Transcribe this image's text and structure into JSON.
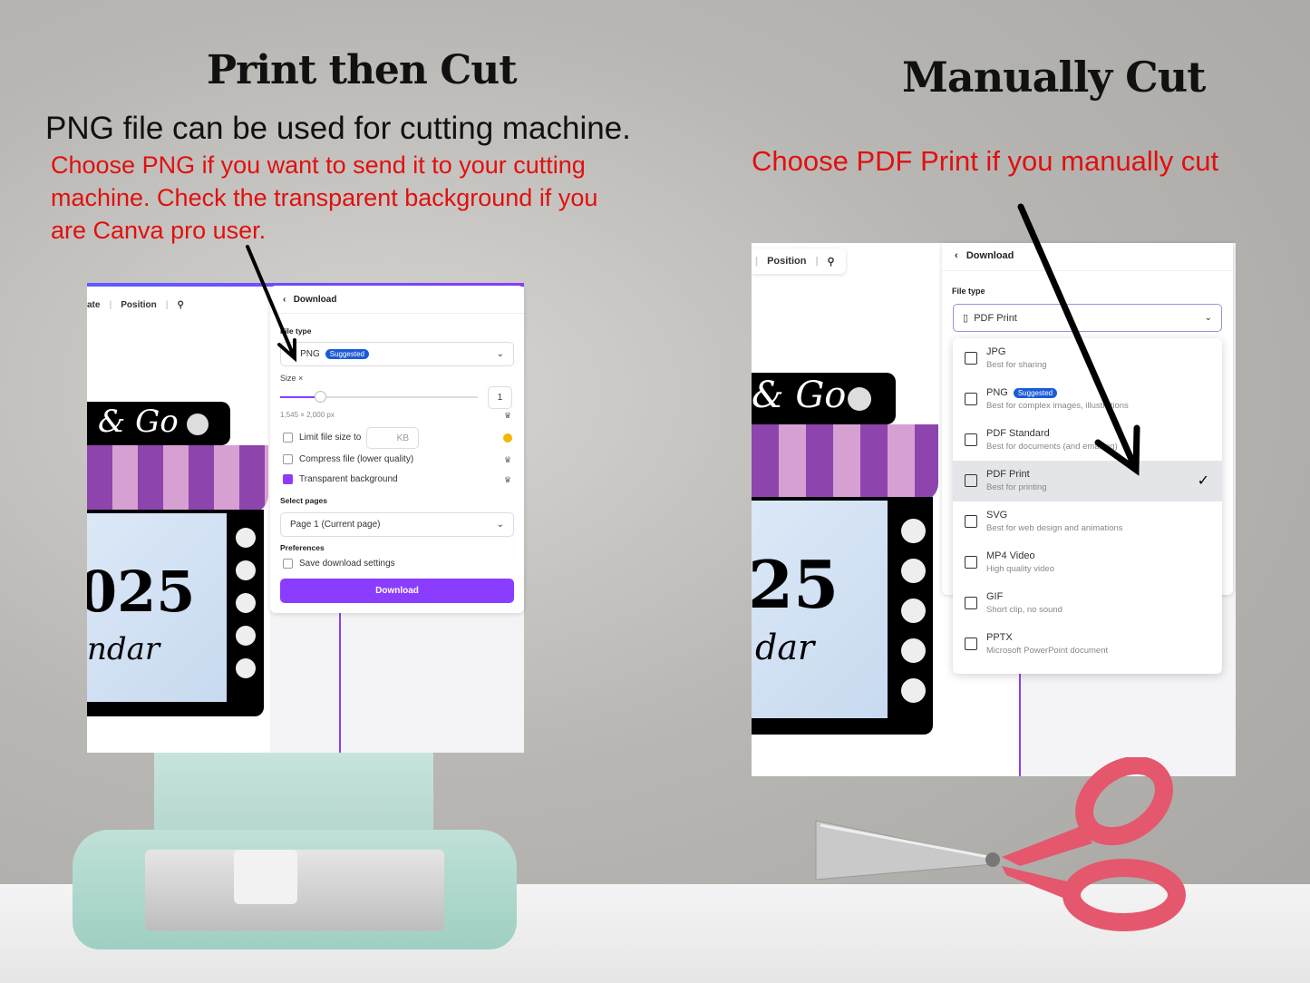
{
  "left": {
    "title": "Print then Cut",
    "subtitle": "PNG file can be used for cutting machine.",
    "instruction": "Choose PNG if you want to send it to your cutting machine.  Check the transparent background if you are Canva pro user.",
    "toolbar": {
      "partial": "ate",
      "position": "Position"
    },
    "download": {
      "header": "Download",
      "file_type_label": "File type",
      "file_type": "PNG",
      "badge": "Suggested",
      "size_label": "Size ×",
      "size_value": "1",
      "size_fraction": 0.2,
      "dimensions": "1,545 × 2,000 px",
      "limit": "Limit file size to",
      "kb": "KB",
      "compress": "Compress file (lower quality)",
      "transparent": "Transparent background",
      "transparent_checked": true,
      "select_pages_label": "Select pages",
      "pages": "Page 1 (Current page)",
      "preferences_label": "Preferences",
      "save_settings": "Save download settings",
      "button": "Download"
    },
    "calendar": {
      "text1": "& Go",
      "text2": "025",
      "text3": "ndar"
    }
  },
  "right": {
    "title": "Manually Cut",
    "instruction": "Choose PDF Print if you manually cut",
    "toolbar": {
      "position": "Position"
    },
    "download": {
      "header": "Download",
      "file_type_label": "File type",
      "file_type": "PDF Print",
      "options": [
        {
          "name": "JPG",
          "desc": "Best for sharing"
        },
        {
          "name": "PNG",
          "desc": "Best for complex images, illustrations",
          "badge": "Suggested"
        },
        {
          "name": "PDF Standard",
          "desc": "Best for documents (and emailing)"
        },
        {
          "name": "PDF Print",
          "desc": "Best for printing",
          "selected": true
        },
        {
          "name": "SVG",
          "desc": "Best for web design and animations"
        },
        {
          "name": "MP4 Video",
          "desc": "High quality video"
        },
        {
          "name": "GIF",
          "desc": "Short clip, no sound"
        },
        {
          "name": "PPTX",
          "desc": "Microsoft PowerPoint document"
        }
      ]
    },
    "calendar": {
      "text1": "& Go",
      "text2": "25",
      "text3": "dar"
    }
  },
  "colors": {
    "accent": "#8b3dff",
    "instruction": "#e01010",
    "badge": "#1a5bd8"
  }
}
